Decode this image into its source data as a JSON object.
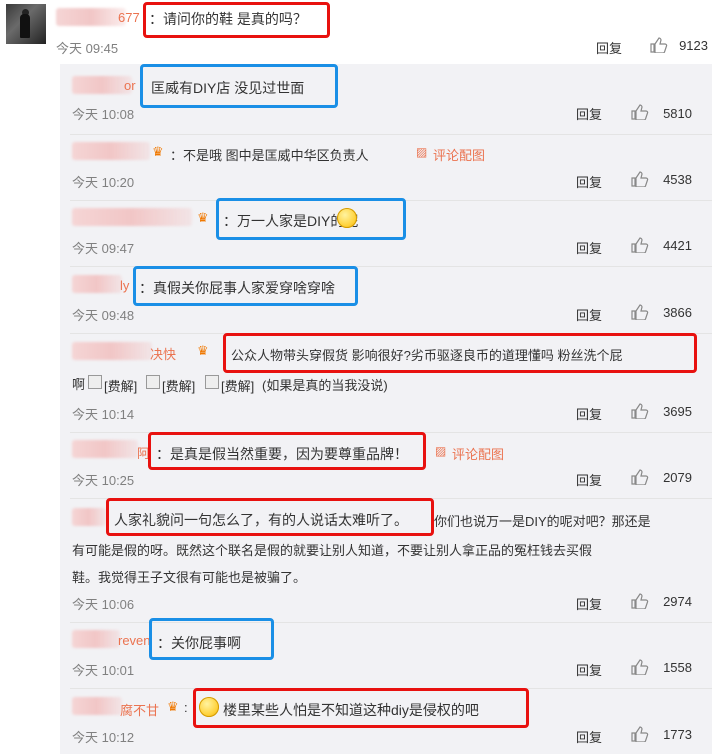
{
  "main_comment": {
    "name_fragment": "677",
    "text": "：请问你的鞋 是真的吗？",
    "time": "今天 09:45",
    "reply": "回复",
    "likes": "9123"
  },
  "replies": [
    {
      "name_fragment": "or",
      "text": "匡威有DIY店 没见过世面",
      "time": "今天 10:08",
      "reply": "回复",
      "likes": "5810"
    },
    {
      "name_fragment": "",
      "text": "：不是哦 图中是匡威中华区负责人",
      "pic_label": "评论配图",
      "time": "今天 10:20",
      "reply": "回复",
      "likes": "4538"
    },
    {
      "name_fragment": "",
      "text": "：万一人家是DIY的呢",
      "time": "今天 09:47",
      "reply": "回复",
      "likes": "4421"
    },
    {
      "name_fragment": "ly",
      "text": "：真假关你屁事人家爱穿啥穿啥",
      "time": "今天 09:48",
      "reply": "回复",
      "likes": "3866"
    },
    {
      "name_fragment": "决快",
      "text": "公众人物带头穿假货 影响很好?劣币驱逐良币的道理懂吗 粉丝洗个屁",
      "text2_a": "啊",
      "text2_img1": "[费解]",
      "text2_img2": "[费解]",
      "text2_img3": "[费解]",
      "text2_b": "(如果是真的当我没说)",
      "time": "今天 10:14",
      "reply": "回复",
      "likes": "3695"
    },
    {
      "name_fragment": "阿",
      "text": "：是真是假当然重要，因为要尊重品牌！",
      "pic_label": "评论配图",
      "time": "今天 10:25",
      "reply": "回复",
      "likes": "2079"
    },
    {
      "name_fragment": "",
      "text": "人家礼貌问一句怎么了，有的人说话太难听了。",
      "text_cont": "你们也说万一是DIY的呢对吧？那还是",
      "line2": "有可能是假的呀。既然这个联名是假的就要让别人知道，不要让别人拿正品的冤枉钱去买假",
      "line3": "鞋。我觉得王子文很有可能也是被骗了。",
      "time": "今天 10:06",
      "reply": "回复",
      "likes": "2974"
    },
    {
      "name_fragment": "reven",
      "text": "：关你屁事啊",
      "time": "今天 10:01",
      "reply": "回复",
      "likes": "1558"
    },
    {
      "name_fragment": "腐不甘",
      "text": "楼里某些人怕是不知道这种diy是侵权的吧",
      "time": "今天 10:12",
      "reply": "回复",
      "likes": "1773"
    }
  ],
  "icons": {
    "like": "thumbs-up-icon",
    "crown": "crown-icon",
    "pic": "image-icon"
  },
  "colors": {
    "highlight_red": "#e8110f",
    "highlight_blue": "#1a8fe6",
    "link": "#eb7350"
  }
}
